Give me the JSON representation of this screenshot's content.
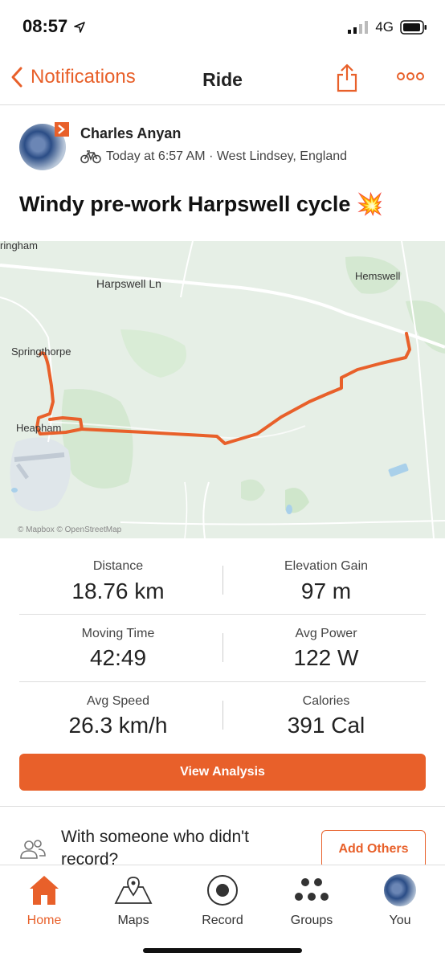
{
  "status_bar": {
    "time": "08:57",
    "network": "4G"
  },
  "nav": {
    "back_label": "Notifications",
    "title": "Ride"
  },
  "activity": {
    "athlete": "Charles Anyan",
    "meta": "Today at 6:57 AM · West Lindsey, England",
    "title": "Windy pre-work Harpswell cycle 💥"
  },
  "map": {
    "labels": {
      "ringham": "ringham",
      "harpswell_ln": "Harpswell Ln",
      "hemswell": "Hemswell",
      "springthorpe": "Springthorpe",
      "heapham": "Heapham",
      "attribution": "© Mapbox © OpenStreetMap"
    },
    "route_color": "#e8602a"
  },
  "stats": [
    {
      "label": "Distance",
      "value": "18.76 km"
    },
    {
      "label": "Elevation Gain",
      "value": "97 m"
    },
    {
      "label": "Moving Time",
      "value": "42:49"
    },
    {
      "label": "Avg Power",
      "value": "122 W"
    },
    {
      "label": "Avg Speed",
      "value": "26.3 km/h"
    },
    {
      "label": "Calories",
      "value": "391 Cal"
    }
  ],
  "view_analysis_label": "View Analysis",
  "others": {
    "prompt": "With someone who didn't record?",
    "button": "Add Others"
  },
  "tabs": [
    {
      "label": "Home",
      "icon": "home-icon"
    },
    {
      "label": "Maps",
      "icon": "maps-icon"
    },
    {
      "label": "Record",
      "icon": "record-icon"
    },
    {
      "label": "Groups",
      "icon": "groups-icon"
    },
    {
      "label": "You",
      "icon": "avatar-icon"
    }
  ],
  "colors": {
    "accent": "#e8602a"
  }
}
